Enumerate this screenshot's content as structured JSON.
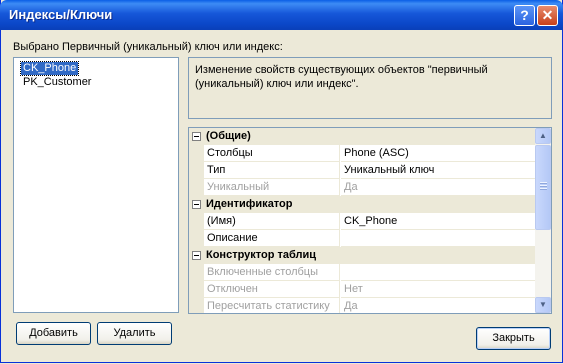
{
  "window": {
    "title": "Индексы/Ключи"
  },
  "titlebar": {
    "help_glyph": "?",
    "close_glyph": "✕"
  },
  "selected_label": "Выбрано Первичный (уникальный) ключ или индекс:",
  "keys_list": {
    "items": [
      {
        "label": "CK_Phone",
        "selected": true
      },
      {
        "label": "PK_Customer",
        "selected": false
      }
    ]
  },
  "description": "Изменение свойств существующих объектов \"первичный (уникальный) ключ или индекс\".",
  "property_grid": {
    "categories": [
      {
        "name": "(Общие)",
        "props": [
          {
            "name": "Столбцы",
            "value": "Phone (ASC)",
            "enabled": true
          },
          {
            "name": "Тип",
            "value": "Уникальный ключ",
            "enabled": true
          },
          {
            "name": "Уникальный",
            "value": "Да",
            "enabled": false
          }
        ]
      },
      {
        "name": "Идентификатор",
        "props": [
          {
            "name": "(Имя)",
            "value": "CK_Phone",
            "enabled": true
          },
          {
            "name": "Описание",
            "value": "",
            "enabled": true
          }
        ]
      },
      {
        "name": "Конструктор таблиц",
        "props": [
          {
            "name": "Включенные столбцы",
            "value": "",
            "enabled": false
          },
          {
            "name": "Отключен",
            "value": "Нет",
            "enabled": false
          },
          {
            "name": "Пересчитать статистику",
            "value": "Да",
            "enabled": false
          }
        ]
      }
    ],
    "scroll_up_glyph": "▲",
    "scroll_down_glyph": "▼"
  },
  "buttons": {
    "add": "Добавить",
    "delete": "Удалить",
    "close": "Закрыть"
  },
  "colors": {
    "titlebar": "#0a4bd0",
    "selection": "#316ac5",
    "dialog_bg": "#ece9d8"
  }
}
